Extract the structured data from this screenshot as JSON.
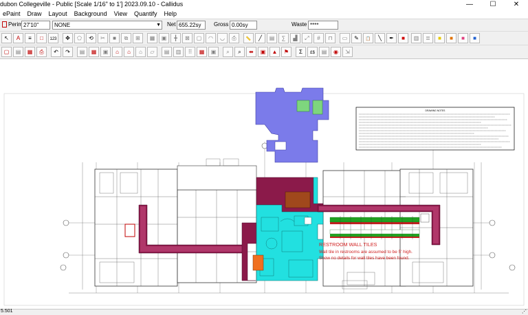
{
  "window": {
    "title": "dubon Collegeville - Public  [Scale 1/16\" to 1']  2023.09.10 - Callidus",
    "minimize": "—",
    "maximize": "☐",
    "close": "✕"
  },
  "menu": [
    "ePaint",
    "Draw",
    "Layout",
    "Background",
    "View",
    "Quantify",
    "Help"
  ],
  "fields": {
    "perim_label": "Perim",
    "perim_value": "27'10\"",
    "style_value": "NONE",
    "net_label": "Net",
    "net_value": "655.22sy",
    "gross_label": "Gross",
    "gross_value": "0.00sy",
    "waste_label": "Waste",
    "waste_value": "****"
  },
  "toolbar_row1": [
    {
      "name": "pointer-tool-icon",
      "glyph": "↖",
      "color": "#000000"
    },
    {
      "name": "text-tool-icon",
      "glyph": "A",
      "color": "#c00000"
    },
    {
      "name": "text-align-icon",
      "glyph": "≡",
      "color": "#000000"
    },
    {
      "name": "rectangle-tool-icon",
      "glyph": "□",
      "color": "#c00000"
    },
    {
      "name": "numbering-tool-icon",
      "glyph": "123",
      "color": "#000000"
    },
    {
      "name": "move-tool-icon",
      "glyph": "✥",
      "color": "#000000"
    },
    {
      "name": "polygon-tool-icon",
      "glyph": "⬠",
      "color": "#808080"
    },
    {
      "name": "rotate-tool-icon",
      "glyph": "⟲",
      "color": "#000000"
    },
    {
      "name": "cut-tool-icon",
      "glyph": "✂",
      "color": "#808080"
    },
    {
      "name": "square-tool-icon",
      "glyph": "■",
      "color": "#808080"
    },
    {
      "name": "copy-tool-icon",
      "glyph": "⧉",
      "color": "#808080"
    },
    {
      "name": "merge-tool-icon",
      "glyph": "⊞",
      "color": "#808080"
    },
    {
      "name": "rug-tool-icon",
      "glyph": "▦",
      "color": "#808080"
    },
    {
      "name": "fill-tool-icon",
      "glyph": "▣",
      "color": "#808080"
    },
    {
      "name": "seam-tool-icon",
      "glyph": "╋",
      "color": "#808080"
    },
    {
      "name": "cut-pattern-icon",
      "glyph": "⊠",
      "color": "#808080"
    },
    {
      "name": "border-tool-icon",
      "glyph": "▢",
      "color": "#808080"
    },
    {
      "name": "curve-tool-icon",
      "glyph": "◠",
      "color": "#808080"
    },
    {
      "name": "arc-tool-icon",
      "glyph": "◡",
      "color": "#808080"
    },
    {
      "name": "print-tool-icon",
      "glyph": "⎙",
      "color": "#808080"
    },
    {
      "name": "ruler-tool-icon",
      "glyph": "📏",
      "color": "#808080"
    },
    {
      "name": "line-tool-icon",
      "glyph": "╱",
      "color": "#000000"
    },
    {
      "name": "hatch-tool-icon",
      "glyph": "▤",
      "color": "#808080"
    },
    {
      "name": "calc-tool-icon",
      "glyph": "∑",
      "color": "#808080"
    },
    {
      "name": "stairs-tool-icon",
      "glyph": "▟",
      "color": "#808080"
    },
    {
      "name": "zoom-extents-icon",
      "glyph": "⤢",
      "color": "#808080"
    },
    {
      "name": "grid-tool-icon",
      "glyph": "#",
      "color": "#808080"
    },
    {
      "name": "door-tool-icon",
      "glyph": "⊓",
      "color": "#808080"
    },
    {
      "name": "vinyl-base-icon",
      "glyph": "▭",
      "color": "#808080"
    },
    {
      "name": "pencil-tool-icon",
      "glyph": "✎",
      "color": "#000000"
    },
    {
      "name": "paste-tool-icon",
      "glyph": "📋",
      "color": "#808080"
    },
    {
      "name": "diagonal-line-icon",
      "glyph": "╲",
      "color": "#000000"
    },
    {
      "name": "pen-line-icon",
      "glyph": "✒",
      "color": "#000000"
    },
    {
      "name": "red-fill-icon",
      "glyph": "■",
      "color": "#d00000"
    },
    {
      "name": "transition-tool-icon",
      "glyph": "▥",
      "color": "#808080"
    },
    {
      "name": "line-weight-icon",
      "glyph": "≣",
      "color": "#808080"
    },
    {
      "name": "yellow-swatch-icon",
      "glyph": "■",
      "color": "#e6c800"
    },
    {
      "name": "orange-swatch-icon",
      "glyph": "■",
      "color": "#e07000"
    },
    {
      "name": "pink-swatch-icon",
      "glyph": "■",
      "color": "#e04080"
    },
    {
      "name": "blue-swatch-icon",
      "glyph": "■",
      "color": "#2060d0"
    }
  ],
  "toolbar_row2": [
    {
      "name": "new-file-icon",
      "glyph": "▢",
      "color": "#c00000"
    },
    {
      "name": "open-file-icon",
      "glyph": "▤",
      "color": "#808080"
    },
    {
      "name": "save-file-icon",
      "glyph": "▦",
      "color": "#c00000"
    },
    {
      "name": "print-icon",
      "glyph": "⎙",
      "color": "#c00000"
    },
    {
      "name": "undo-icon",
      "glyph": "↶",
      "color": "#000000"
    },
    {
      "name": "redo-icon",
      "glyph": "↷",
      "color": "#000000"
    },
    {
      "name": "room-list-icon",
      "glyph": "▤",
      "color": "#808080"
    },
    {
      "name": "color-palette-icon",
      "glyph": "▦",
      "color": "#c00000"
    },
    {
      "name": "layer-icon",
      "glyph": "▣",
      "color": "#808080"
    },
    {
      "name": "house-icon",
      "glyph": "⌂",
      "color": "#c00000"
    },
    {
      "name": "house-plus-icon",
      "glyph": "⌂",
      "color": "#c00000"
    },
    {
      "name": "house-minus-icon",
      "glyph": "⌂",
      "color": "#808080"
    },
    {
      "name": "shape-icon",
      "glyph": "▱",
      "color": "#808080"
    },
    {
      "name": "report-icon",
      "glyph": "▤",
      "color": "#808080"
    },
    {
      "name": "report-alt-icon",
      "glyph": "▥",
      "color": "#808080"
    },
    {
      "name": "grid-dots-icon",
      "glyph": "⠿",
      "color": "#808080"
    },
    {
      "name": "tile-pattern-icon",
      "glyph": "▦",
      "color": "#c00000"
    },
    {
      "name": "image-icon",
      "glyph": "▣",
      "color": "#808080"
    },
    {
      "name": "zoom-window-icon",
      "glyph": "⌕",
      "color": "#808080"
    },
    {
      "name": "magnifier-icon",
      "glyph": "⌕",
      "color": "#000000"
    },
    {
      "name": "fit-width-icon",
      "glyph": "⬌",
      "color": "#c00000"
    },
    {
      "name": "red-box-icon",
      "glyph": "▣",
      "color": "#c00000"
    },
    {
      "name": "north-arrow-icon",
      "glyph": "▲",
      "color": "#c00000"
    },
    {
      "name": "red-flag-icon",
      "glyph": "⚑",
      "color": "#c00000"
    },
    {
      "name": "sigma-icon",
      "glyph": "Σ",
      "color": "#000000"
    },
    {
      "name": "pounds-dollars-icon",
      "glyph": "£$",
      "color": "#000000"
    },
    {
      "name": "estimate-icon",
      "glyph": "▤",
      "color": "#808080"
    },
    {
      "name": "search-icon",
      "glyph": "◉",
      "color": "#c00000"
    },
    {
      "name": "export-icon",
      "glyph": "⇲",
      "color": "#808080"
    }
  ],
  "drawing": {
    "notes_title": "DRAWING NOTES",
    "restroom_title": "RESTROOM WALL TILES",
    "restroom_line1": "Wall tile in restrooms are assumed to be 5' high.",
    "restroom_line2": "Show no details for wall tiles have been found."
  },
  "statusbar": {
    "left": "5.501"
  }
}
